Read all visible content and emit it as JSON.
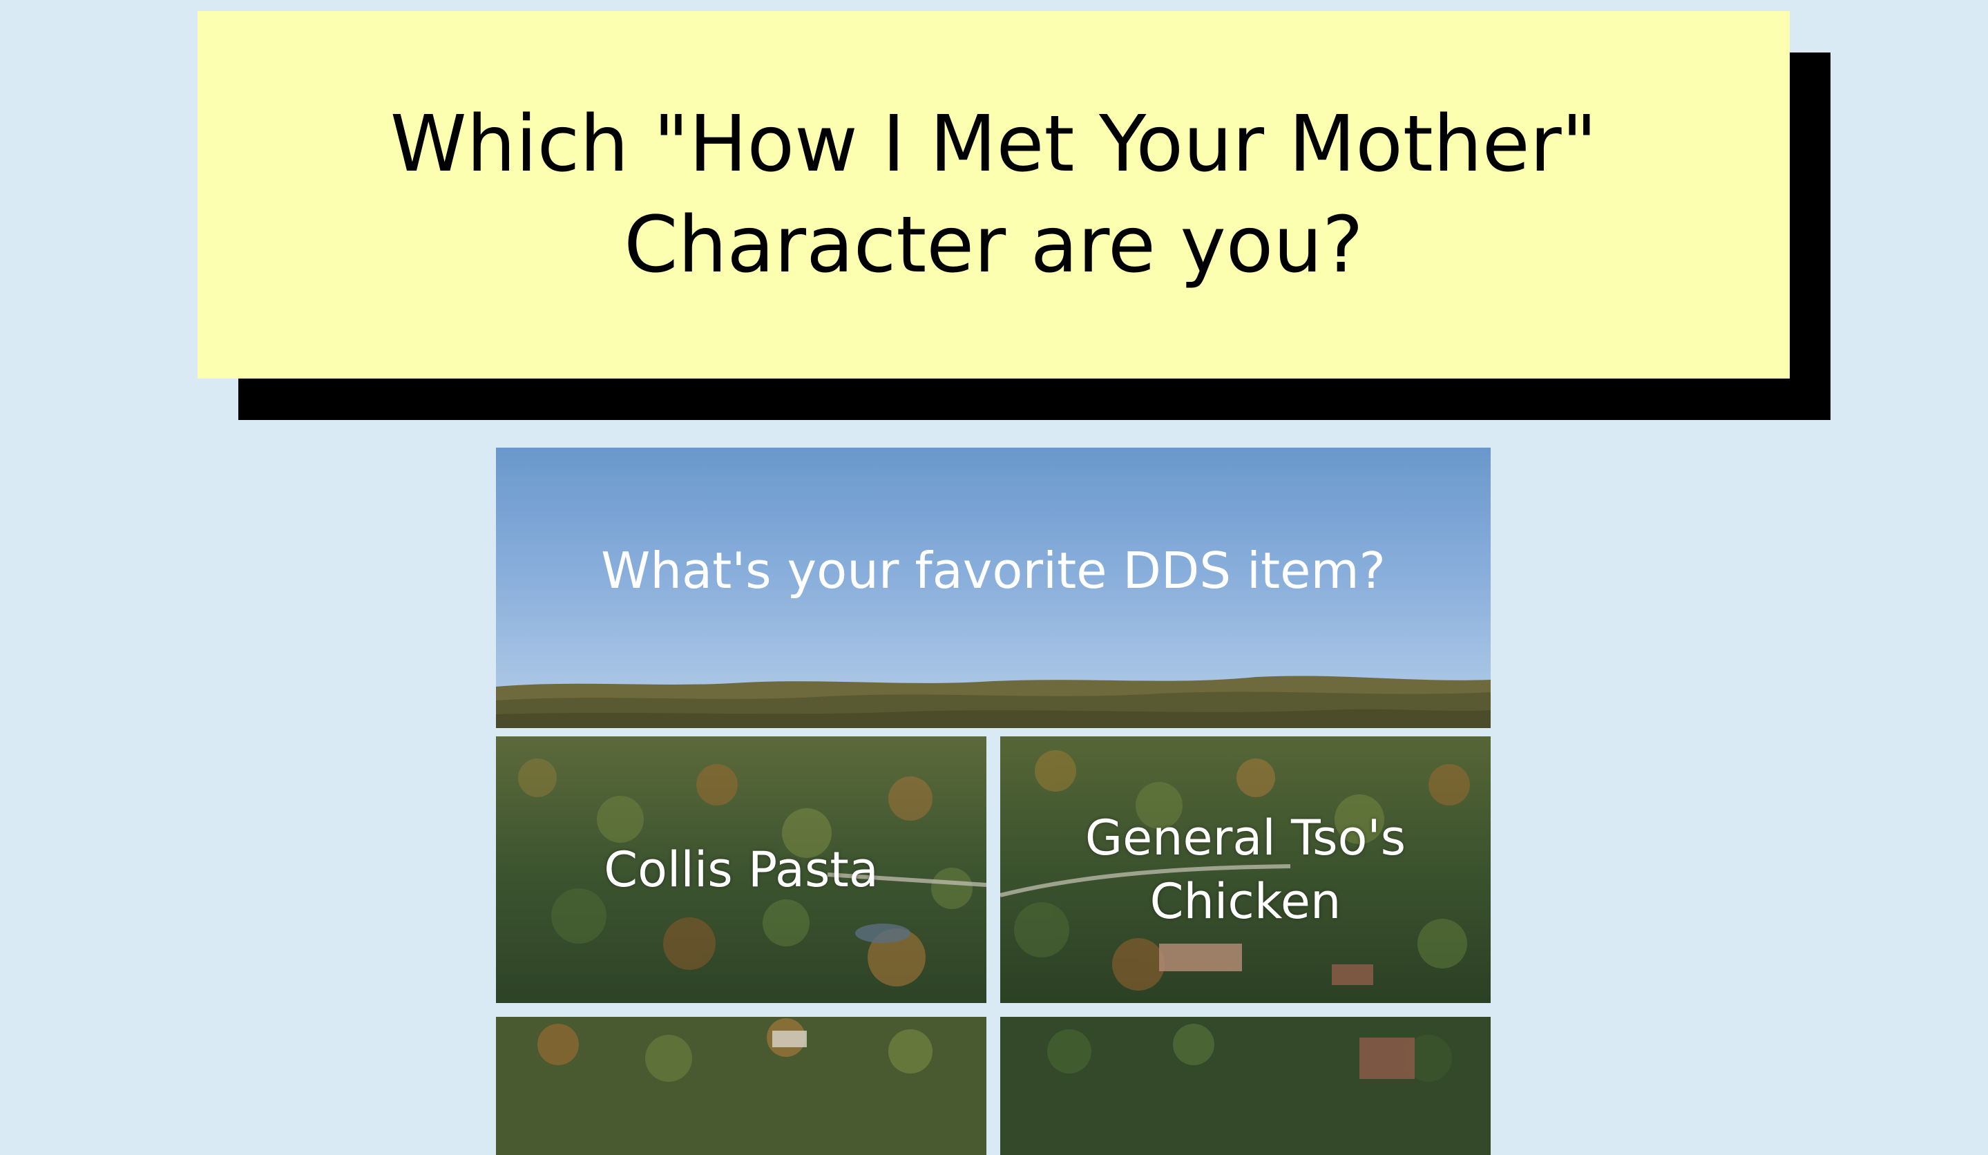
{
  "quiz": {
    "title": "Which \"How I Met Your Mother\" Character are you?",
    "question": "What's your favorite DDS item?",
    "answers": [
      {
        "label": "Collis Pasta"
      },
      {
        "label": "General Tso's Chicken"
      },
      {
        "label": ""
      },
      {
        "label": ""
      }
    ]
  },
  "colors": {
    "page_background": "#daeaf5",
    "title_card": "#fdffb0",
    "title_shadow": "#000000",
    "answer_text": "#ffffff"
  }
}
